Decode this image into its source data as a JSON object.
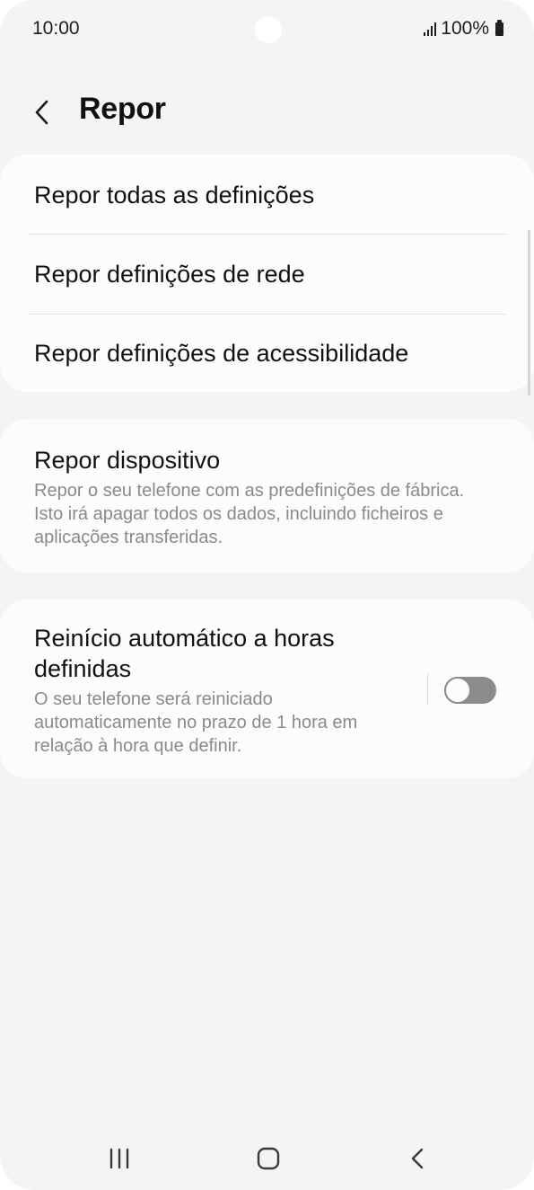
{
  "status_bar": {
    "time": "10:00",
    "battery": "100%"
  },
  "header": {
    "title": "Repor"
  },
  "reset_options": [
    {
      "label": "Repor todas as definições"
    },
    {
      "label": "Repor definições de rede"
    },
    {
      "label": "Repor definições de acessibilidade"
    }
  ],
  "factory_reset": {
    "title": "Repor dispositivo",
    "description": "Repor o seu telefone com as predefinições de fábrica. Isto irá apagar todos os dados, incluindo ficheiros e aplicações transferidas."
  },
  "auto_restart": {
    "title": "Reinício automático a horas definidas",
    "description": "O seu telefone será reiniciado automaticamente no prazo de 1 hora em relação à hora que definir.",
    "enabled": false
  },
  "icons": {
    "back": "chevron-left-icon",
    "signal": "signal-icon",
    "battery": "battery-icon",
    "nav_recents": "recents-icon",
    "nav_home": "home-icon",
    "nav_back": "back-icon"
  },
  "colors": {
    "background": "#f4f4f4",
    "card": "#fcfcfc",
    "text": "#111111",
    "secondary_text": "#8a8a8a",
    "toggle_off": "#8b8b8b"
  }
}
